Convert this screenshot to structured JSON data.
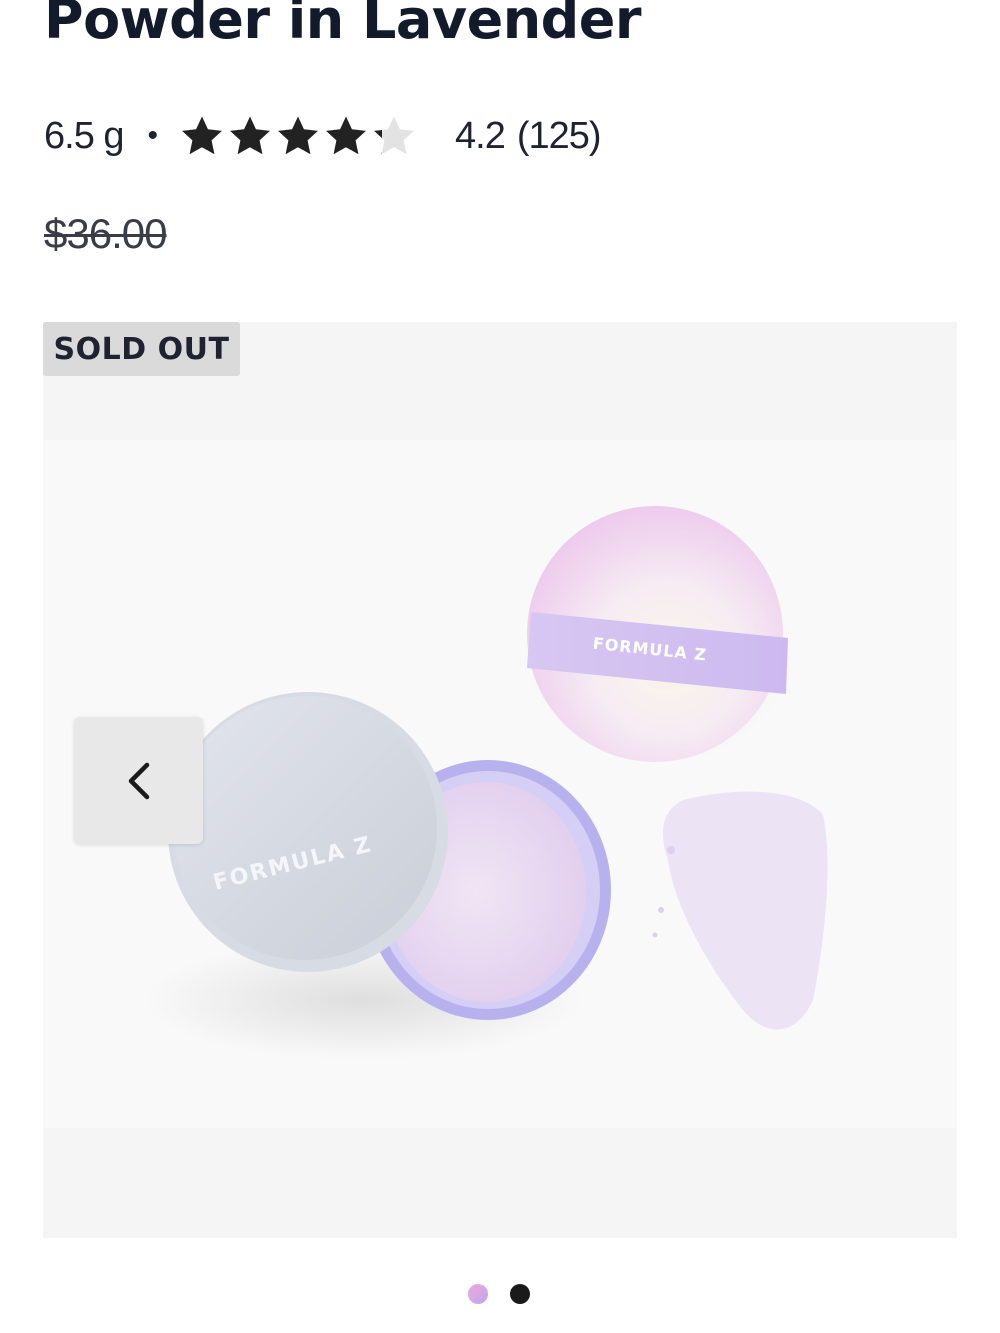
{
  "product": {
    "title": "Powder in Lavender",
    "size": "6.5 g",
    "separator": "•",
    "rating": 4.2,
    "rating_display": "4.2",
    "review_count_display": "(125)",
    "max_stars": 5,
    "original_price": "$36.00"
  },
  "gallery": {
    "badge": "SOLD OUT",
    "prev_icon": "chevron-left-icon",
    "image_brand_text": "FORMULA Z",
    "dots": [
      {
        "active": false,
        "color": "#e8a0e8"
      },
      {
        "active": true,
        "color": "#1a1a1a"
      }
    ]
  },
  "colors": {
    "star_fill": "#222222",
    "star_empty": "#e3e3e3",
    "accent_lavender": "#b9a8f0"
  }
}
